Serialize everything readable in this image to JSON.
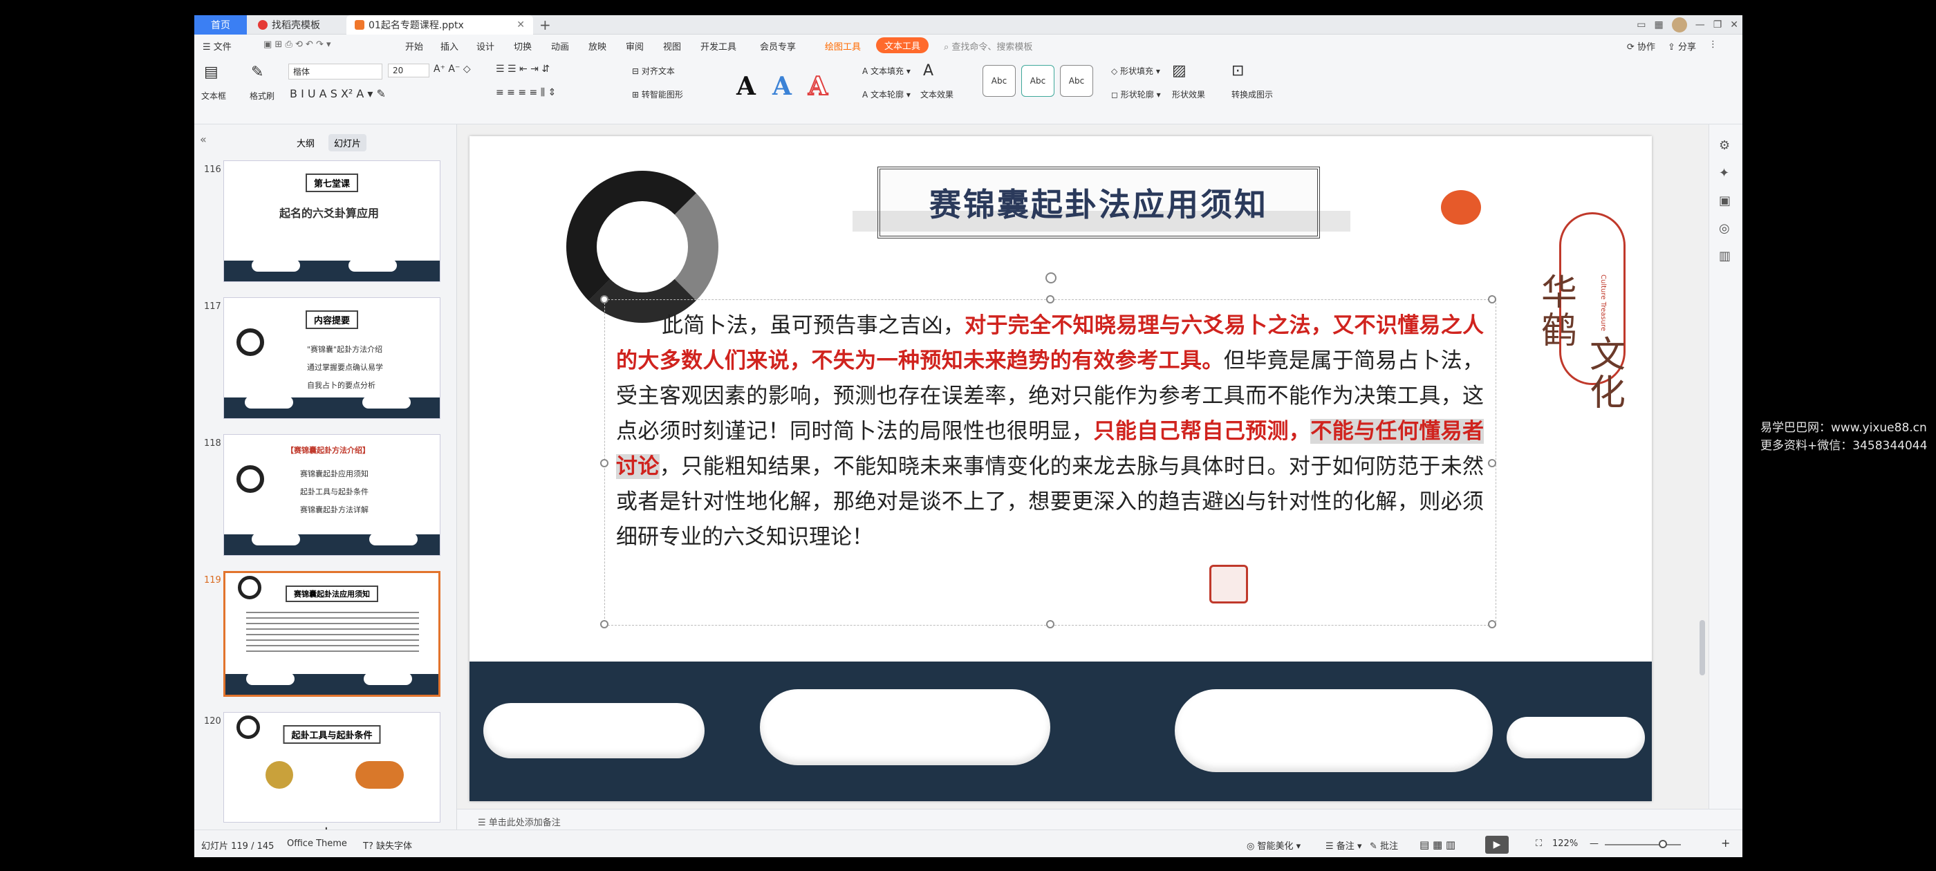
{
  "tabs": {
    "home": "首页",
    "template": "找稻壳模板",
    "file": "01起名专题课程.pptx"
  },
  "menu": {
    "file": "文件",
    "items": [
      "开始",
      "插入",
      "设计",
      "切换",
      "动画",
      "放映",
      "审阅",
      "视图",
      "开发工具",
      "会员专享"
    ],
    "draw_tool": "绘图工具",
    "text_tool": "文本工具",
    "search": "查找命令、搜索模板",
    "collab": "协作",
    "share": "分享"
  },
  "ribbon": {
    "textbox": "文本框",
    "format_painter": "格式刷",
    "font": "楷体",
    "size": "20",
    "align_text": "对齐文本",
    "smartart": "转智能图形",
    "text_fill": "文本填充",
    "text_outline": "文本轮廓",
    "text_effect": "文本效果",
    "style_sample": "Abc",
    "shape_fill": "形状填充",
    "shape_outline": "形状轮廓",
    "shape_effect": "形状效果",
    "convert": "转换成图示"
  },
  "pane": {
    "outline": "大纲",
    "slides": "幻灯片"
  },
  "thumbs": [
    {
      "num": "116",
      "title": "第七堂课",
      "sub": "起名的六爻卦算应用"
    },
    {
      "num": "117",
      "title": "内容提要",
      "items": [
        "\"赛锦囊\"起卦方法介绍",
        "通过掌握要点确认易学",
        "自我占卜的要点分析"
      ]
    },
    {
      "num": "118",
      "title": "【赛锦囊起卦方法介绍】",
      "items": [
        "赛锦囊起卦应用须知",
        "起卦工具与起卦条件",
        "赛锦囊起卦方法详解"
      ]
    },
    {
      "num": "119",
      "title": "赛锦囊起卦法应用须知"
    },
    {
      "num": "120",
      "title": "起卦工具与起卦条件"
    }
  ],
  "slide": {
    "title": "赛锦囊起卦法应用须知",
    "brand1": "华\n鹤",
    "brand2": "文\n化",
    "brand_en": "Culture Treasure",
    "p1": "此简卜法，虽可预告事之吉凶，",
    "r1": "对于完全不知晓易理与六爻易卜之法，又不识懂易之人的大多数人们来说，不失为一种预知未来趋势的有效参考工具。",
    "p2": "但毕竟是属于简易占卜法，受主客观因素的影响，预测也存在误差率，绝对只能作为参考工具而不能作为决策工具，这点必须时刻谨记！同时简卜法的局限性也很明显，",
    "r2": "只能自己帮自己预测，",
    "h1": "不能与任何懂易者讨论",
    "p3": "，只能粗知结果，不能知晓未来事情变化的来龙去脉与具体时日。对于如何防范于未然或者是针对性地化解，那绝对是谈不上了，想要更深入的趋吉避凶与针对性的化解，则必须细研专业的六爻知识理论！"
  },
  "notes": "单击此处添加备注",
  "status": {
    "slide": "幻灯片 119 / 145",
    "theme": "Office Theme",
    "font_missing": "缺失字体",
    "smart": "智能美化",
    "notes": "备注",
    "comment": "批注",
    "zoom": "122%"
  },
  "watermark": {
    "line1": "易学巴巴网：www.yixue88.cn",
    "line2": "更多资料+微信：3458344044"
  },
  "colors": {
    "accent": "#ff6a2c",
    "slide_red": "#d0231e",
    "sea": "#1f3347"
  }
}
